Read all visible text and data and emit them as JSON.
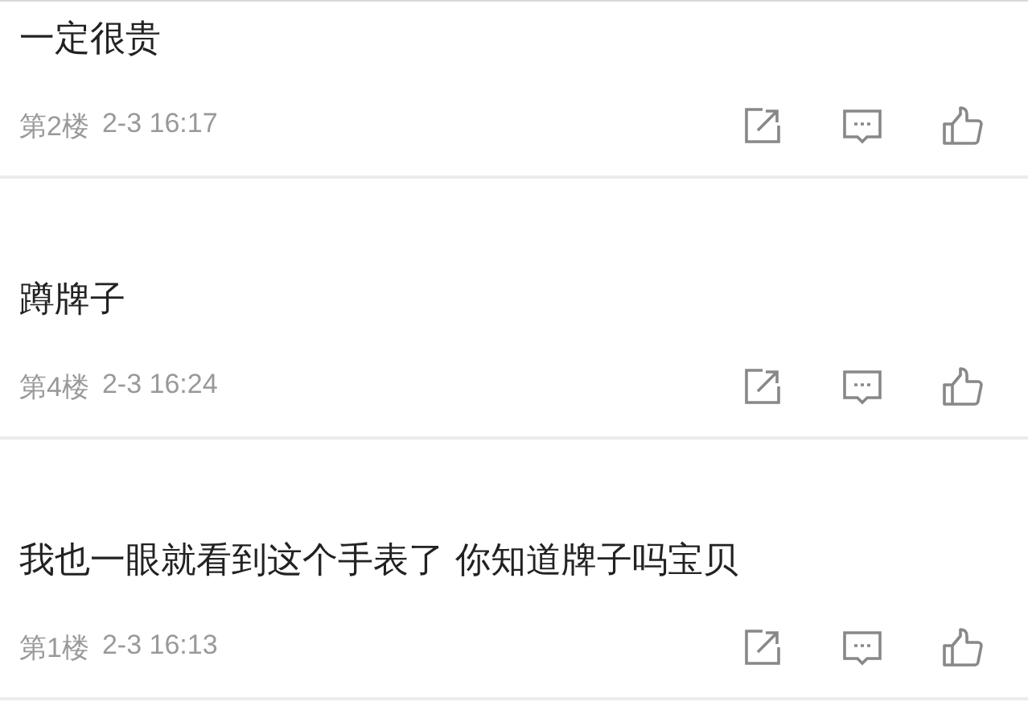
{
  "comments": [
    {
      "text": "一定很贵",
      "floor": "第2楼",
      "time": "2-3 16:17"
    },
    {
      "text": "蹲牌子",
      "floor": "第4楼",
      "time": "2-3 16:24"
    },
    {
      "text": "我也一眼就看到这个手表了 你知道牌子吗宝贝",
      "floor": "第1楼",
      "time": "2-3 16:13"
    }
  ]
}
